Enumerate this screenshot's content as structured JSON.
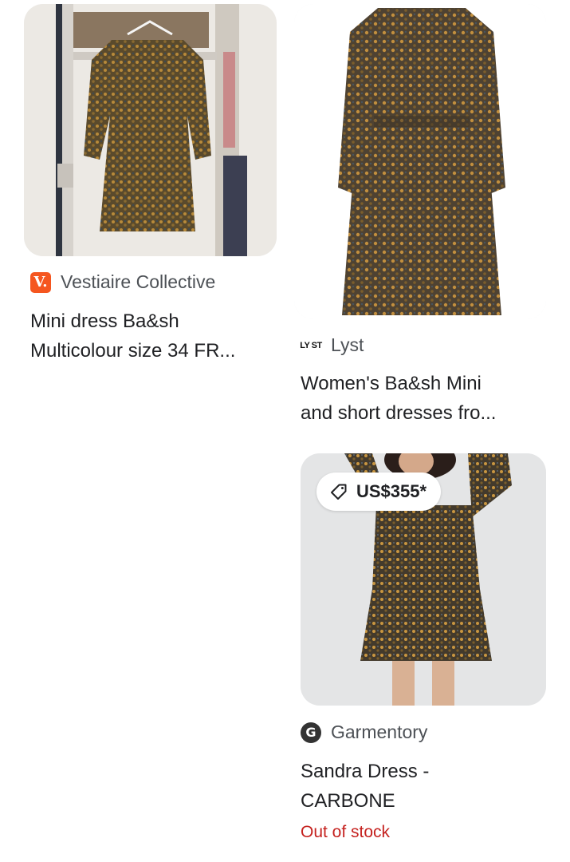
{
  "results": [
    {
      "source": "Vestiaire Collective",
      "favicon_letter": "V.",
      "title_line1": "Mini dress Ba&sh",
      "title_line2": "Multicolour size 34 FR...",
      "image_icon": "dress-on-hanger-image"
    },
    {
      "source": "Lyst",
      "favicon_letter": "LY ST",
      "title_line1": "Women's Ba&sh Mini",
      "title_line2": "and short dresses fro...",
      "image_icon": "dress-product-image"
    },
    {
      "source": "Garmentory",
      "favicon_letter": "G",
      "price": "US$355*",
      "title_line1": "Sandra Dress -",
      "title_line2": "CARBONE",
      "stock_status": "Out of stock",
      "image_icon": "model-in-dress-image"
    }
  ],
  "colors": {
    "vestiaire_brand": "#f5561f",
    "out_of_stock": "#c5221f",
    "source_text": "#4d5156",
    "title_text": "#202124"
  }
}
